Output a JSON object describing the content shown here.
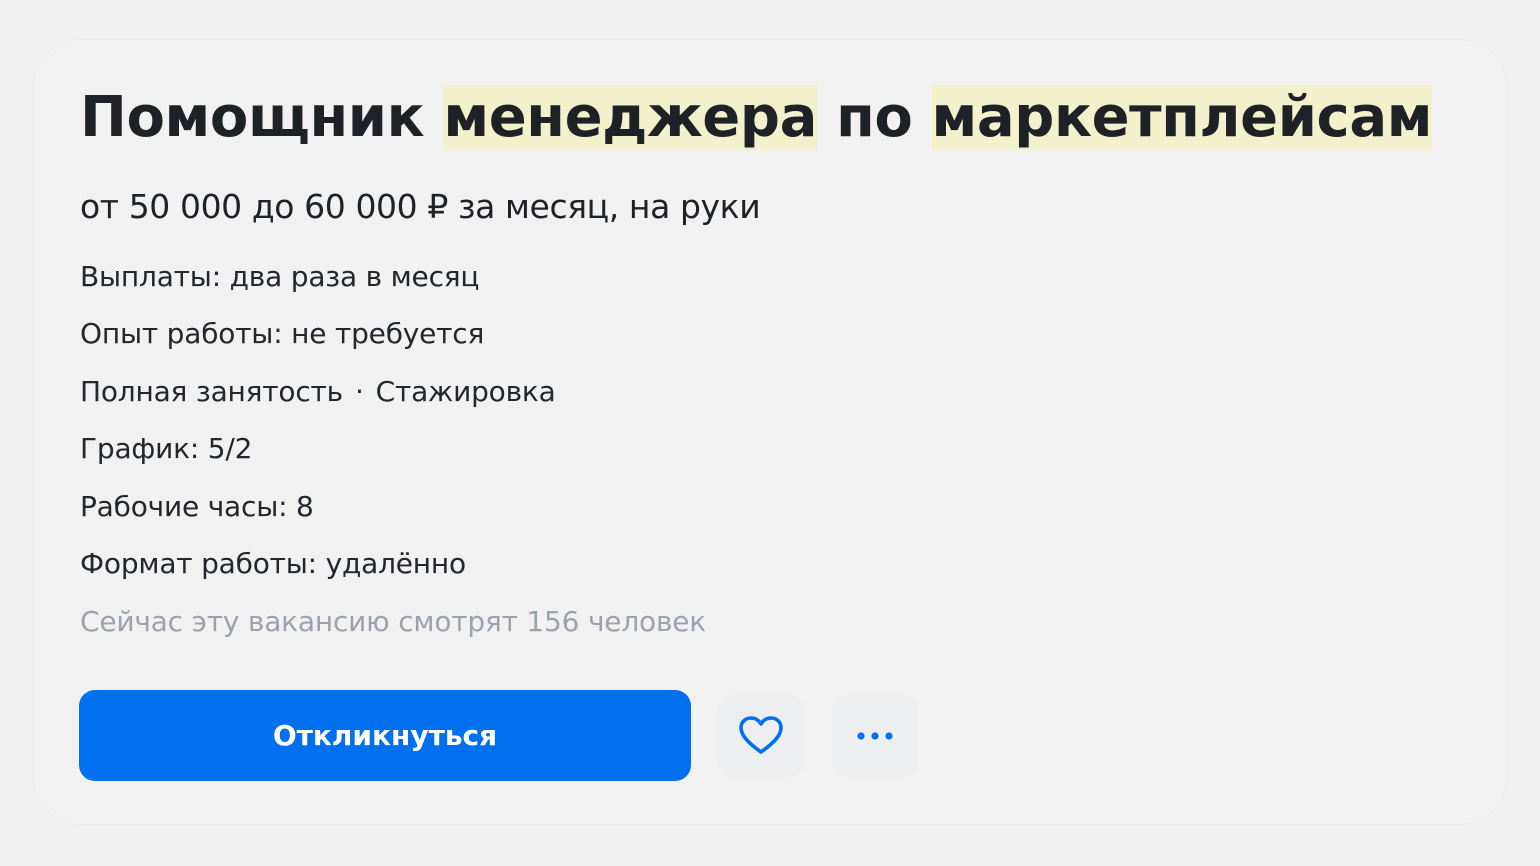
{
  "vacancy": {
    "title_parts": [
      "Помощник ",
      "менеджера",
      " по ",
      "маркетплейсам"
    ],
    "salary": "от 50 000 до 60 000 ₽ за месяц, на руки",
    "payouts": "Выплаты: два раза в месяц",
    "experience": "Опыт работы: не требуется",
    "employment": "Полная занятость",
    "separator": "·",
    "internship": "Стажировка",
    "schedule": "График: 5/2",
    "hours": "Рабочие часы: 8",
    "format": "Формат работы: удалённо",
    "viewers": "Сейчас эту вакансию смотрят 156 человек"
  },
  "actions": {
    "respond_label": "Откликнуться",
    "favorite_icon": "heart-icon",
    "more_icon": "more-dots-icon"
  },
  "colors": {
    "accent": "#0070ee",
    "highlight": "#f2f1cc",
    "muted_text": "#9aa3ad"
  }
}
